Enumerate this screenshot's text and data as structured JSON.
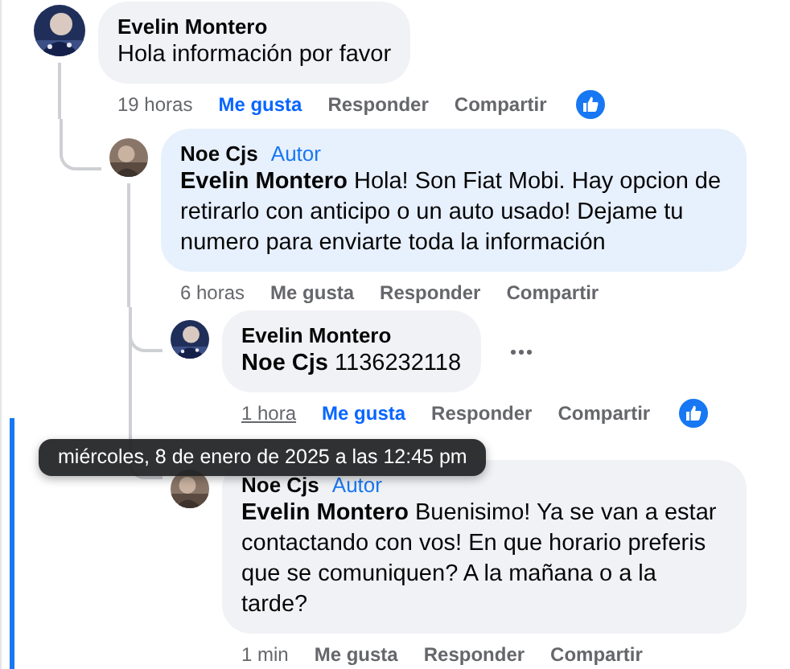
{
  "comments": [
    {
      "author": "Evelin Montero",
      "text": "Hola información por favor",
      "color": "#f0f2f5",
      "time": "19 horas",
      "time_hovered": false,
      "like": "Me gusta",
      "liked": true,
      "reply": "Responder",
      "share": "Compartir",
      "reaction": true,
      "more_menu": false,
      "highlighted": false,
      "children": [
        {
          "author": "Noe Cjs",
          "badge": "Autor",
          "text": "**Evelin Montero** Hola! Son Fiat Mobi. Hay opcion de retirarlo con anticipo o un auto usado! Dejame tu numero para enviarte toda la información",
          "color": "#e7f0fd",
          "time": "6 horas",
          "time_hovered": false,
          "like": "Me gusta",
          "liked": false,
          "reply": "Responder",
          "share": "Compartir",
          "reaction": false,
          "more_menu": false,
          "highlighted": false,
          "children": [
            {
              "author": "Evelin Montero",
              "text": "**Noe Cjs** 1136232118",
              "color": "#f0f2f5",
              "time": "1 hora",
              "time_hovered": true,
              "like": "Me gusta",
              "liked": true,
              "reply": "Responder",
              "share": "Compartir",
              "reaction": true,
              "more_menu": true,
              "highlighted": false
            },
            {
              "author": "Noe Cjs",
              "badge": "Autor",
              "text": "**Evelin Montero** Buenisimo! Ya se van a estar contactando con vos! En que horario preferis que se comuniquen? A la mañana o a la tarde?",
              "color": "#f0f2f5",
              "time": "1 min",
              "time_hovered": false,
              "like": "Me gusta",
              "liked": false,
              "reply": "Responder",
              "share": "Compartir",
              "reaction": false,
              "more_menu": false,
              "highlighted": true
            }
          ]
        }
      ]
    }
  ],
  "tooltip": {
    "text": "miércoles, 8 de enero de 2025 a las 12:45 pm"
  }
}
